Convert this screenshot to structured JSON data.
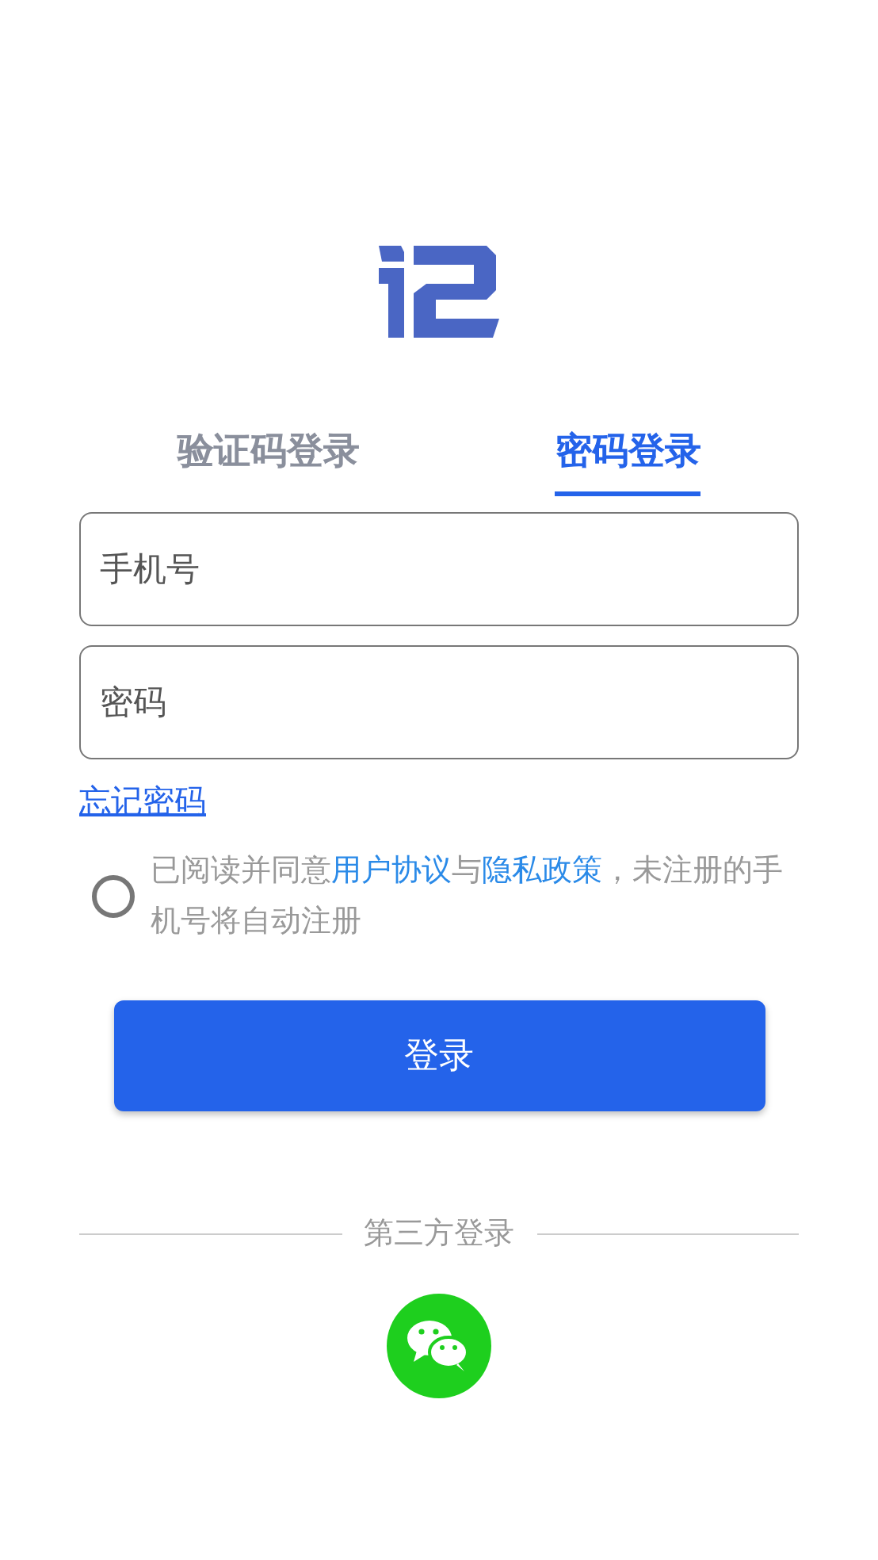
{
  "tabs": [
    {
      "label": "验证码登录",
      "selected": false
    },
    {
      "label": "密码登录",
      "selected": true
    }
  ],
  "fields": [
    {
      "placeholder": "手机号"
    },
    {
      "placeholder": "密码"
    }
  ],
  "forgot_link": "忘记密码",
  "agreement": {
    "checked": false,
    "parts": [
      {
        "kind": "text",
        "text": "已阅读并同意"
      },
      {
        "kind": "link",
        "text": "用户协议"
      },
      {
        "kind": "text",
        "text": "与"
      },
      {
        "kind": "link",
        "text": "隐私政策"
      },
      {
        "kind": "text",
        "text": "，未注册的手机号将自动注册"
      }
    ]
  },
  "login_button": "登录",
  "third_party": {
    "label": "第三方登录"
  }
}
